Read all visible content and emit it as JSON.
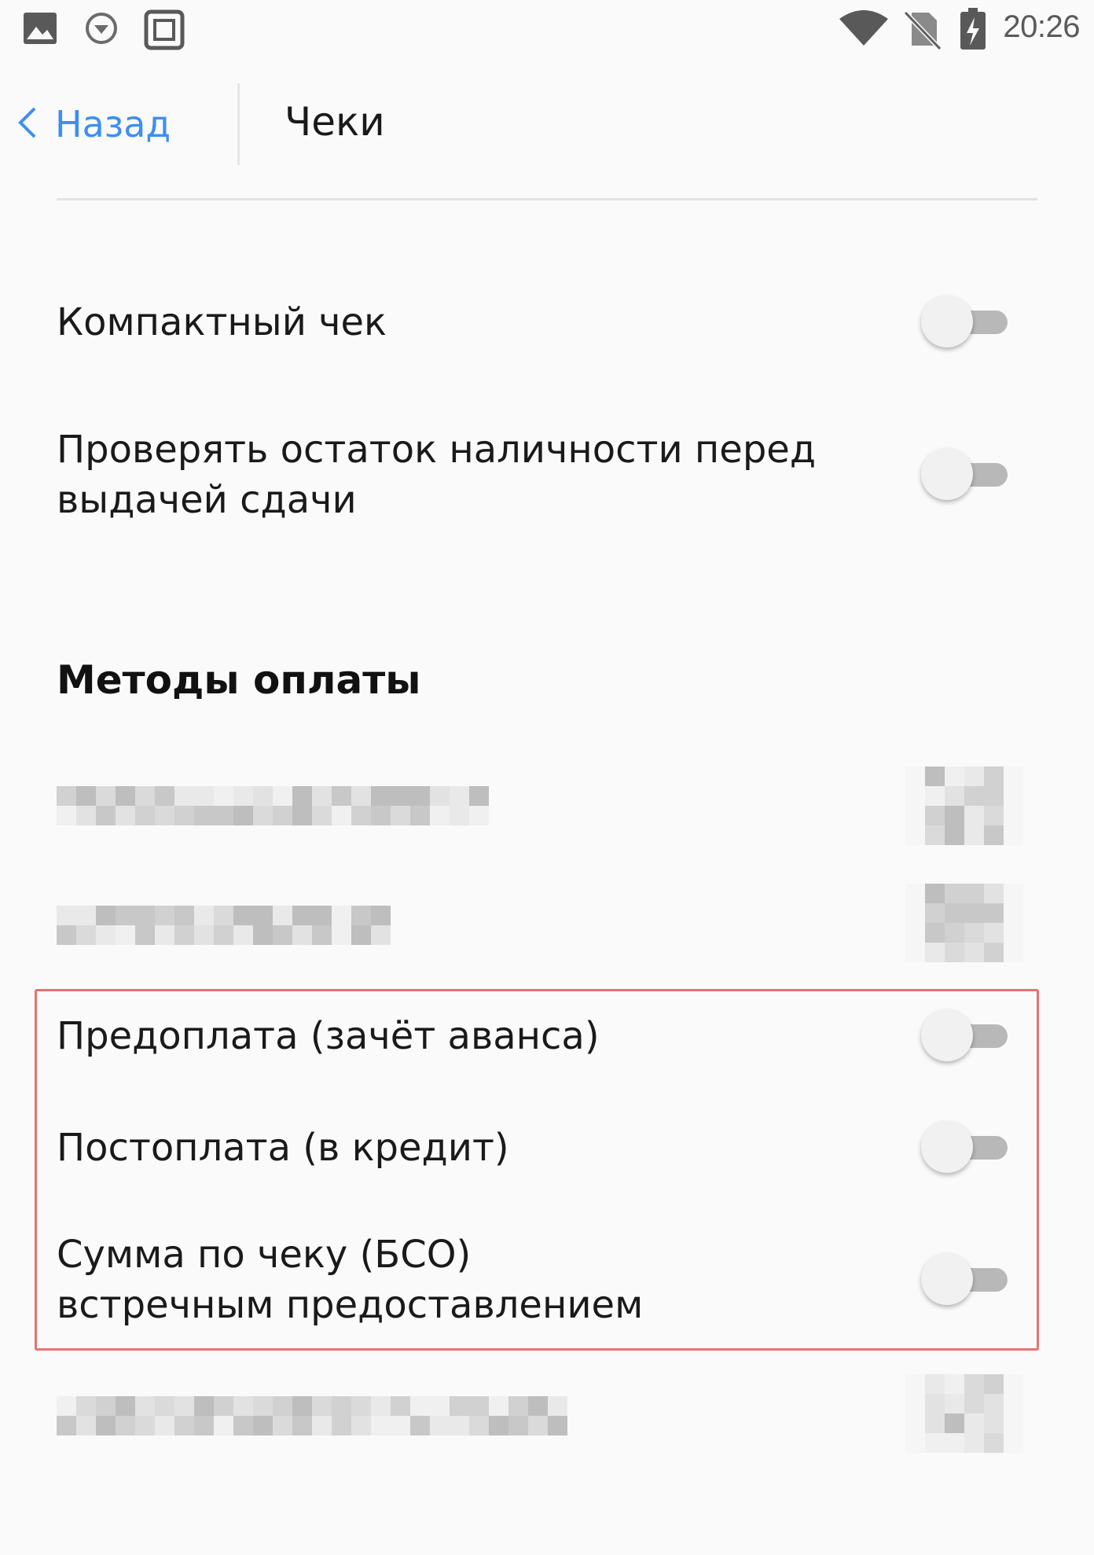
{
  "status_bar": {
    "time": "20:26",
    "left_icons": [
      "image-icon",
      "download-circle-icon",
      "screenshot-icon"
    ],
    "right_icons": [
      "wifi-icon",
      "no-sim-icon",
      "battery-charging-icon"
    ]
  },
  "nav": {
    "back_label": "Назад",
    "title": "Чеки",
    "accent_color": "#3d8ef0"
  },
  "settings": {
    "compact_receipt": {
      "label": "Компактный чек",
      "enabled": false
    },
    "check_cash": {
      "label_line1": "Проверять остаток наличности перед",
      "label_line2": "выдачей сдачи",
      "enabled": false
    }
  },
  "payment_methods": {
    "title": "Методы оплаты",
    "prepayment": {
      "label": "Предоплата (зачёт аванса)",
      "enabled": false
    },
    "postpayment": {
      "label": "Постоплата (в кредит)",
      "enabled": false
    },
    "counter_provision": {
      "label_line1": "Сумма по чеку (БСО)",
      "label_line2": "встречным предоставлением",
      "enabled": false
    }
  },
  "highlight_color": "#e57373"
}
